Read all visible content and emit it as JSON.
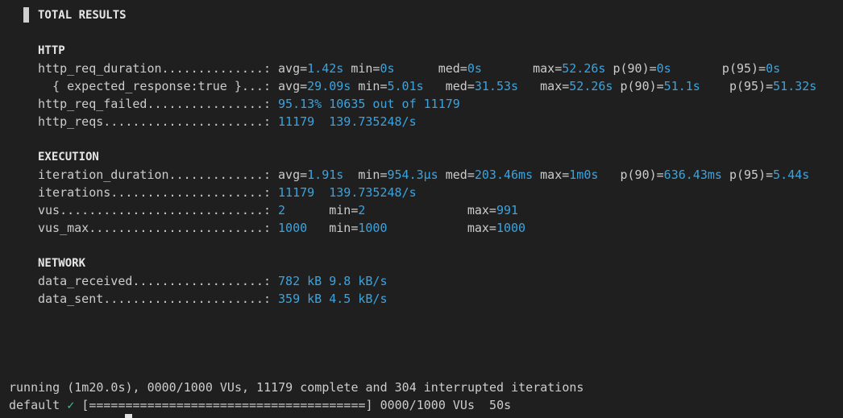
{
  "header": {
    "title": "TOTAL RESULTS"
  },
  "http": {
    "section": "HTTP",
    "req_duration": {
      "label": "http_req_duration..............: ",
      "avg_k": "avg=",
      "avg_v": "1.42s",
      "min_k": " min=",
      "min_v": "0s",
      "med_k": "      med=",
      "med_v": "0s",
      "max_k": "       max=",
      "max_v": "52.26s",
      "p90_k": " p(90)=",
      "p90_v": "0s",
      "p95_k": "       p(95)=",
      "p95_v": "0s"
    },
    "expected": {
      "label": "  { expected_response:true }...: ",
      "avg_k": "avg=",
      "avg_v": "29.09s",
      "min_k": " min=",
      "min_v": "5.01s",
      "med_k": "   med=",
      "med_v": "31.53s",
      "max_k": "   max=",
      "max_v": "52.26s",
      "p90_k": " p(90)=",
      "p90_v": "51.1s",
      "p95_k": "    p(95)=",
      "p95_v": "51.32s"
    },
    "req_failed": {
      "label": "http_req_failed................: ",
      "value": "95.13% 10635 out of 11179"
    },
    "reqs": {
      "label": "http_reqs......................: ",
      "value": "11179  139.735248/s"
    }
  },
  "execution": {
    "section": "EXECUTION",
    "iteration_duration": {
      "label": "iteration_duration.............: ",
      "avg_k": "avg=",
      "avg_v": "1.91s",
      "min_k": "  min=",
      "min_v": "954.3µs",
      "med_k": " med=",
      "med_v": "203.46ms",
      "max_k": " max=",
      "max_v": "1m0s",
      "p90_k": "   p(90)=",
      "p90_v": "636.43ms",
      "p95_k": " p(95)=",
      "p95_v": "5.44s"
    },
    "iterations": {
      "label": "iterations.....................: ",
      "value": "11179  139.735248/s"
    },
    "vus": {
      "label": "vus............................: ",
      "value": "2",
      "min_k": "      min=",
      "min_v": "2",
      "max_k": "              max=",
      "max_v": "991"
    },
    "vus_max": {
      "label": "vus_max........................: ",
      "value": "1000",
      "min_k": "   min=",
      "min_v": "1000",
      "max_k": "           max=",
      "max_v": "1000"
    }
  },
  "network": {
    "section": "NETWORK",
    "received": {
      "label": "data_received..................: ",
      "value": "782 kB 9.8 kB/s"
    },
    "sent": {
      "label": "data_sent......................: ",
      "value": "359 kB 4.5 kB/s"
    }
  },
  "footer": {
    "running": "running (1m20.0s), 0000/1000 VUs, 11179 complete and 304 interrupted iterations",
    "scenario": "default",
    "check": "✓",
    "progress": "[======================================] 0000/1000 VUs  50s",
    "progress_fraction": 1.0
  },
  "colors": {
    "value": "#3aa4e0",
    "check": "#39c28a",
    "background": "#1f1f1f"
  }
}
